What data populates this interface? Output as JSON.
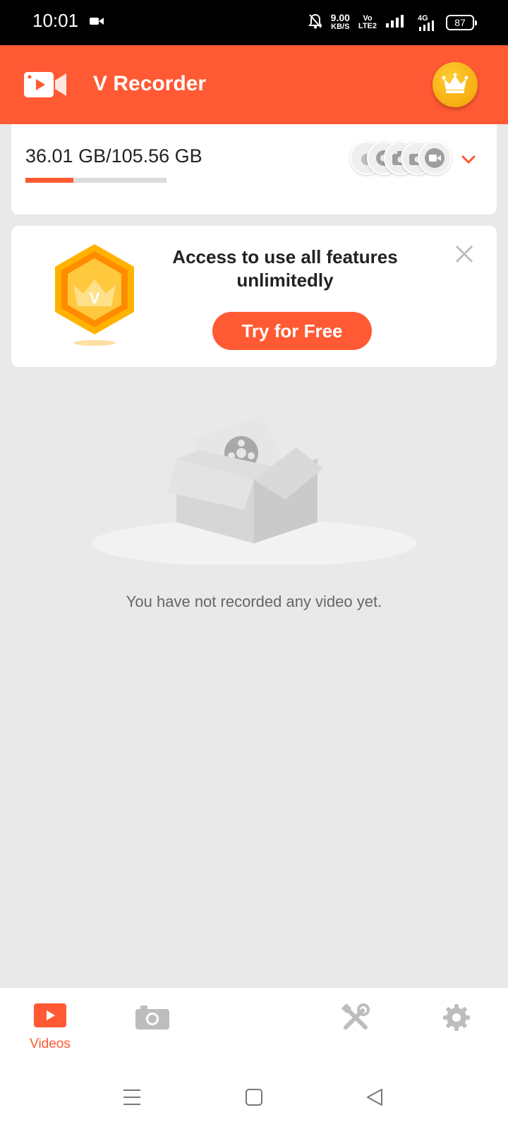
{
  "status_bar": {
    "time": "10:01",
    "net_speed_value": "9.00",
    "net_speed_unit": "KB/S",
    "volte_top": "Vo",
    "volte_bottom": "LTE2",
    "signal2_label": "4G",
    "battery": "87"
  },
  "app_bar": {
    "title": "V Recorder",
    "logo_icon": "video-camera-logo-icon",
    "premium_icon": "crown-icon"
  },
  "storage": {
    "text": "36.01 GB/105.56 GB",
    "used_fraction": 0.341,
    "source_icons": [
      "bubble-icon",
      "webcam-icon",
      "camera-icon",
      "camera-icon",
      "video-camera-icon"
    ]
  },
  "promo": {
    "title": "Access to use all features unlimitedly",
    "cta": "Try for Free",
    "badge_letter": "V"
  },
  "empty_state": {
    "message": "You have not recorded any video yet."
  },
  "bottom_nav": {
    "items": [
      {
        "label": "Videos",
        "icon": "play-icon",
        "active": true
      },
      {
        "label": "",
        "icon": "camera-icon",
        "active": false
      },
      {
        "label": "",
        "icon": "tools-icon",
        "active": false
      },
      {
        "label": "",
        "icon": "gear-icon",
        "active": false
      }
    ]
  },
  "colors": {
    "accent": "#ff5a33",
    "background": "#e9e9e9",
    "gold": "#f7b500"
  }
}
